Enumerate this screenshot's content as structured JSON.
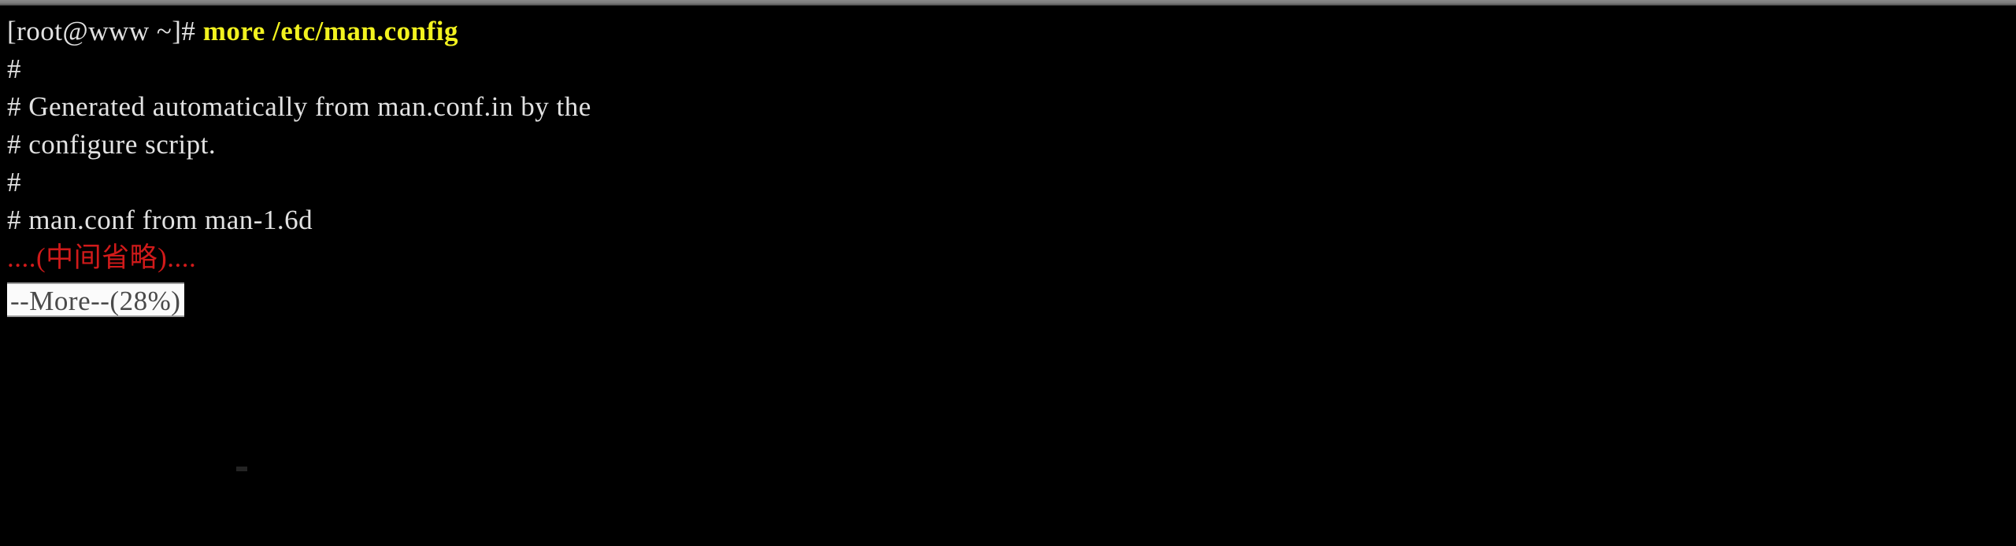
{
  "terminal": {
    "background_color": "#000000",
    "default_fg_color": "#e2e2e2",
    "accent_yellow": "#f2f21f",
    "accent_red": "#d01a1a",
    "status_bg": "#fbfbfb",
    "status_fg": "#4a4a4a",
    "prompt": {
      "text": "[root@www ~]# ",
      "command": "more /etc/man.config"
    },
    "output_lines": [
      {
        "text": "#"
      },
      {
        "text": "# Generated automatically from man.conf.in by the"
      },
      {
        "text": "# configure script."
      },
      {
        "text": "#"
      },
      {
        "text": "# man.conf from man-1.6d"
      }
    ],
    "omission_note": "....(中间省略)....",
    "pager_status": "--More--(28%)"
  }
}
